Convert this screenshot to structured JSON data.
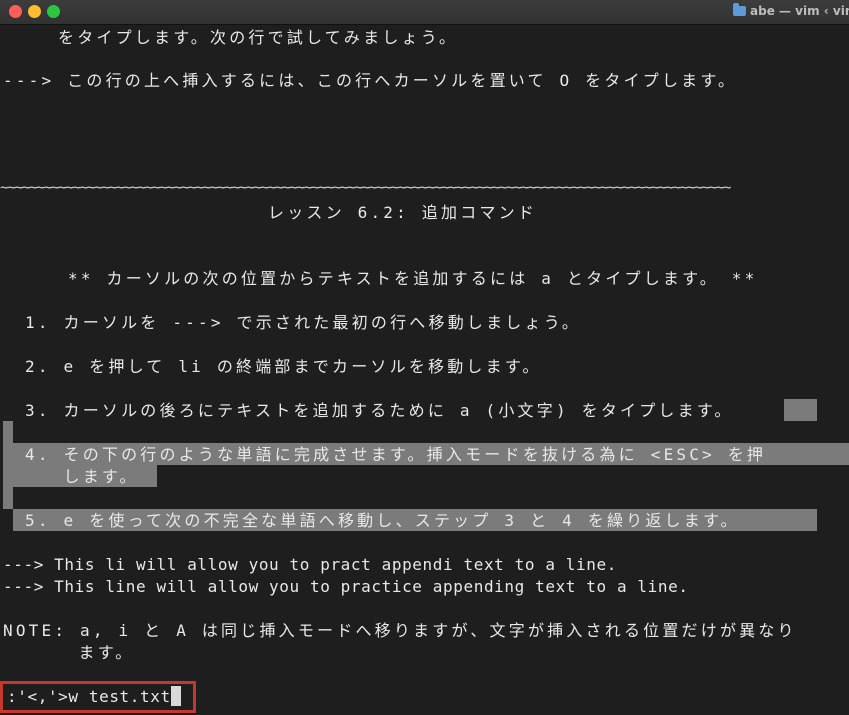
{
  "window": {
    "title": "abe — vim ‹ vim",
    "icon": "folder-icon",
    "traffic_lights": [
      "#ff5f57",
      "#febc2e",
      "#28c840"
    ]
  },
  "tutor": {
    "line_prev_tail": "をタイプします。次の行で試してみましょう。",
    "line_prev_arrow": "---> この行の上へ挿入するには、この行へカーソルを置いて O をタイプします。",
    "separator": "~~~~~~~~~~~~~~~~~~~~~~~~~~~~~~~~~~~~~~~~~~~~~~~~~~~~~~~~~~~~~~~~~~~~~~~~~~~~~~~~~~~~~~~~~~~~~~~~~~~~~",
    "lesson_title": "レッスン 6.2: 追加コマンド",
    "lesson_summary": "** カーソルの次の位置からテキストを追加するには a とタイプします。 **",
    "step1": "1. カーソルを ---> で示された最初の行へ移動しましょう。",
    "step2": "2. e を押して li の終端部までカーソルを移動します。",
    "step3": "3. カーソルの後ろにテキストを追加するために a (小文字) をタイプします。",
    "step4_a": "4. その下の行のような単語に完成させます。挿入モードを抜ける為に <ESC> を押",
    "step4_b": "   します。",
    "step5": "5. e を使って次の不完全な単語へ移動し、ステップ 3 と 4 を繰り返します。",
    "example_bad": "---> This li will allow you to pract appendi text to a line.",
    "example_good": "---> This line will allow you to practice appending text to a line.",
    "note_a": "NOTE: a, i と A は同じ挿入モードへ移りますが、文字が挿入される位置だけが異なり",
    "note_b": "   ます。"
  },
  "command_line": {
    "text": ":'<,'>w test.txt"
  },
  "colors": {
    "background": "#1e1e1e",
    "selection": "#7b7b7b",
    "highlight_border": "#c8372d"
  }
}
